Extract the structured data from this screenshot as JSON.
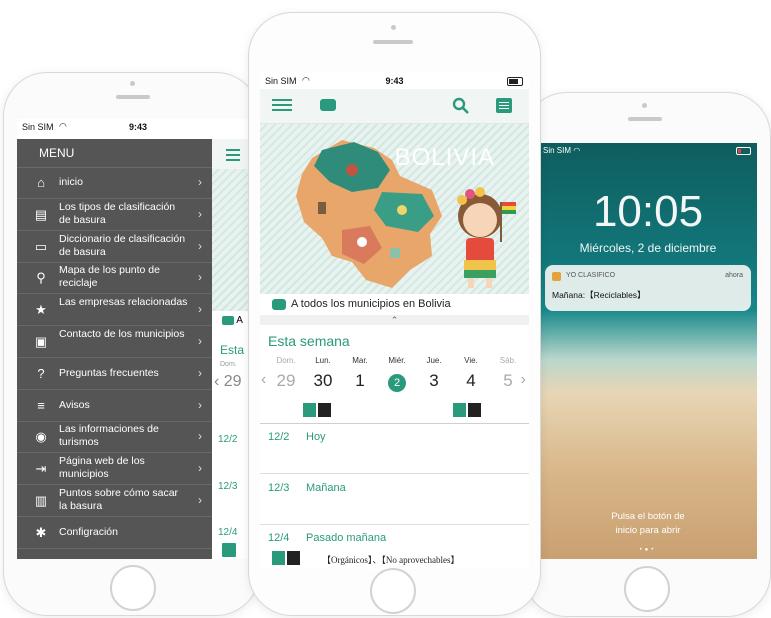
{
  "status": {
    "carrier": "Sin SIM",
    "time": "9:43",
    "wifi_icon": "wifi-icon",
    "battery_icon": "battery-icon"
  },
  "menu": {
    "title": "MENU",
    "items": [
      {
        "label": "inicio",
        "icon": "home-icon"
      },
      {
        "label": "Los tipos de clasificación de basura",
        "icon": "book-icon"
      },
      {
        "label": "Diccionario de clasificación de basura",
        "icon": "open-book-icon"
      },
      {
        "label": "Mapa de los punto de reciclaje",
        "icon": "map-pin-icon"
      },
      {
        "label": "Las empresas relacionadas",
        "icon": "star-icon"
      },
      {
        "label": "Contacto de los municipios",
        "icon": "contact-card-icon"
      },
      {
        "label": "Preguntas frecuentes",
        "icon": "question-icon"
      },
      {
        "label": "Avisos",
        "icon": "notice-icon"
      },
      {
        "label": "Las informaciones de turismos",
        "icon": "camera-icon"
      },
      {
        "label": "Página web de los municipios",
        "icon": "link-out-icon"
      },
      {
        "label": "Puntos sobre cómo sacar la basura",
        "icon": "list-book-icon"
      },
      {
        "label": "Configración",
        "icon": "gear-icon"
      }
    ]
  },
  "behind_menu": {
    "fragment_a": "A",
    "fragment_week": "Esta",
    "fragment_dom": "Dom.",
    "fragment_29": "29",
    "dates": [
      "12/2",
      "12/3",
      "12/4"
    ]
  },
  "main": {
    "banner_title": "BOLIVIA",
    "notice": "A todos los municipios en Bolivia",
    "week_title": "Esta semana",
    "days": [
      {
        "name": "Dom.",
        "num": "29",
        "muted": true
      },
      {
        "name": "Lun.",
        "num": "30",
        "muted": false
      },
      {
        "name": "Mar.",
        "num": "1",
        "muted": false
      },
      {
        "name": "Miér.",
        "num": "2",
        "muted": false,
        "today": true
      },
      {
        "name": "Jue.",
        "num": "3",
        "muted": false
      },
      {
        "name": "Vie.",
        "num": "4",
        "muted": false
      },
      {
        "name": "Sáb.",
        "num": "5",
        "muted": true
      }
    ],
    "rows": [
      {
        "date": "12/2",
        "label": "Hoy"
      },
      {
        "date": "12/3",
        "label": "Mañana"
      },
      {
        "date": "12/4",
        "label": "Pasado mañana"
      }
    ],
    "tags": "【Orgánicos】、【No aprovechables】",
    "accent": "#2a9a7c"
  },
  "lockscreen": {
    "carrier": "Sin SIM",
    "time": "10:05",
    "date": "Miércoles, 2 de diciembre",
    "notif_app": "YO CLASIFICO",
    "notif_when": "ahora",
    "notif_body": "Mañana:【Reciclables】",
    "unlock_text_1": "Pulsa el botón de",
    "unlock_text_2": "inicio para abrir"
  }
}
